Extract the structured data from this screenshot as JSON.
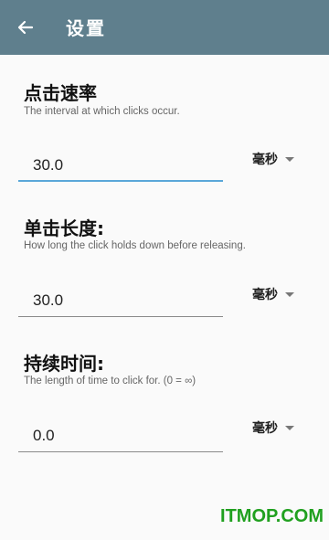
{
  "header": {
    "title": "设置"
  },
  "sections": [
    {
      "title": "点击速率",
      "desc": "The interval at which clicks occur.",
      "value": "30.0",
      "unit": "毫秒"
    },
    {
      "title": "单击长度:",
      "desc": "How long the click holds down before releasing.",
      "value": "30.0",
      "unit": "毫秒"
    },
    {
      "title": "持续时间:",
      "desc": "The length of time to click for. (0 = ∞)",
      "value": "0.0",
      "unit": "毫秒"
    }
  ],
  "watermark": "ITMOP.COM"
}
